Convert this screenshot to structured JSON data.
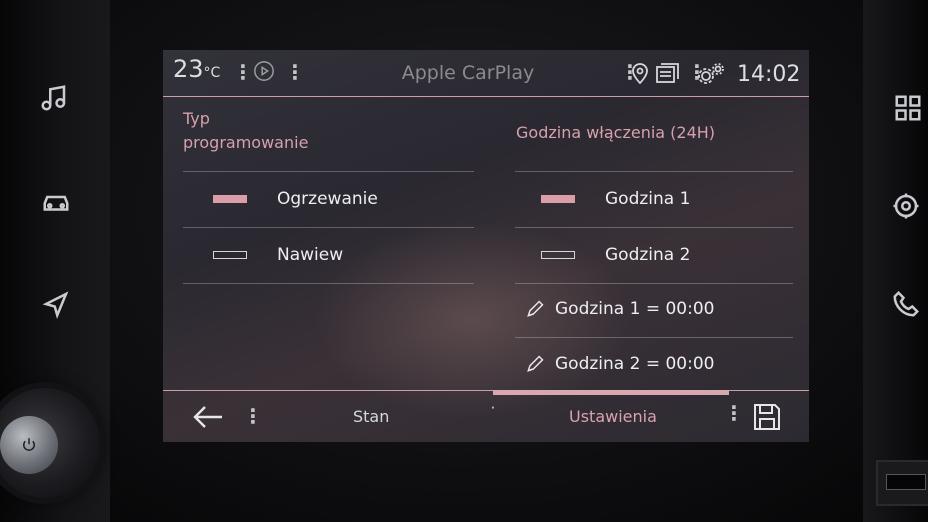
{
  "status": {
    "temperature": "23",
    "temperature_unit": "°C",
    "app_title": "Apple CarPlay",
    "time": "14:02"
  },
  "left_column": {
    "heading_line1": "Typ",
    "heading_line2": "programowanie",
    "options": [
      {
        "label": "Ogrzewanie",
        "selected": true
      },
      {
        "label": "Nawiew",
        "selected": false
      }
    ]
  },
  "right_column": {
    "heading": "Godzina włączenia (24H)",
    "options": [
      {
        "label": "Godzina 1",
        "selected": true
      },
      {
        "label": "Godzina 2",
        "selected": false
      }
    ],
    "edit_items": [
      {
        "label": "Godzina 1 = 00:00"
      },
      {
        "label": "Godzina 2 = 00:00"
      }
    ]
  },
  "bottom": {
    "tabs": [
      {
        "label": "Stan",
        "active": false
      },
      {
        "label": "Ustawienia",
        "active": true
      }
    ]
  },
  "icons": {
    "side_left": [
      "music-icon",
      "car-icon",
      "navigation-icon"
    ],
    "side_right": [
      "apps-grid-icon",
      "settings-icon",
      "phone-icon"
    ],
    "status": [
      "play-icon",
      "location-pin-icon",
      "messages-icon",
      "gears-icon"
    ]
  },
  "colors": {
    "accent_pink": "#d99ea8",
    "text_light": "#eeeef2",
    "screen_bg": "#2e2c33"
  }
}
